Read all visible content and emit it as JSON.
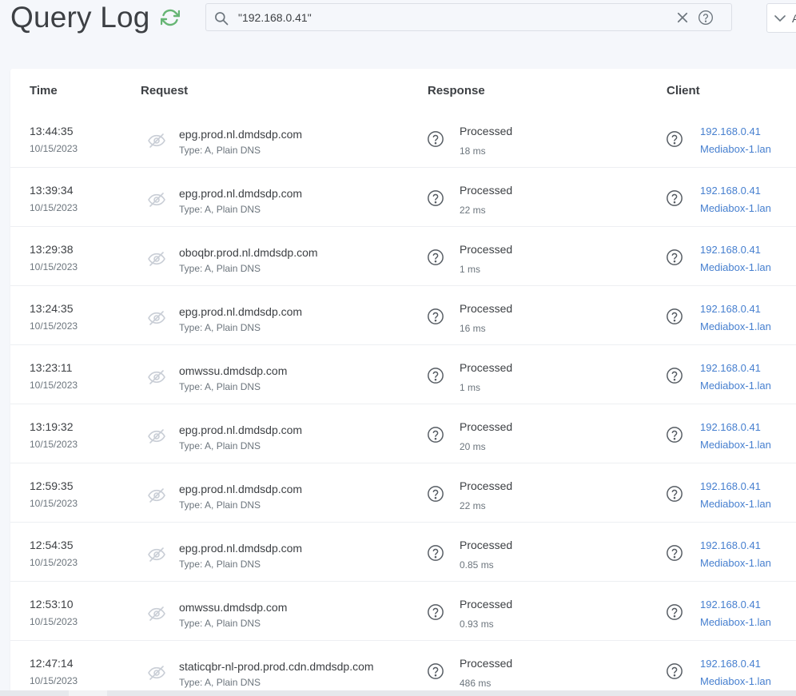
{
  "header": {
    "title": "Query Log",
    "refresh_icon": "refresh-icon",
    "search": {
      "value": "\"192.168.0.41\"",
      "placeholder": ""
    },
    "filter": {
      "label": "A"
    }
  },
  "table": {
    "columns": {
      "time": "Time",
      "request": "Request",
      "response": "Response",
      "client": "Client"
    },
    "rows": [
      {
        "time": "13:44:35",
        "date": "10/15/2023",
        "domain": "epg.prod.nl.dmdsdp.com",
        "type": "Type: A, Plain DNS",
        "status": "Processed",
        "elapsed": "18 ms",
        "ip": "192.168.0.41",
        "name": "Mediabox-1.lan"
      },
      {
        "time": "13:39:34",
        "date": "10/15/2023",
        "domain": "epg.prod.nl.dmdsdp.com",
        "type": "Type: A, Plain DNS",
        "status": "Processed",
        "elapsed": "22 ms",
        "ip": "192.168.0.41",
        "name": "Mediabox-1.lan"
      },
      {
        "time": "13:29:38",
        "date": "10/15/2023",
        "domain": "oboqbr.prod.nl.dmdsdp.com",
        "type": "Type: A, Plain DNS",
        "status": "Processed",
        "elapsed": "1 ms",
        "ip": "192.168.0.41",
        "name": "Mediabox-1.lan"
      },
      {
        "time": "13:24:35",
        "date": "10/15/2023",
        "domain": "epg.prod.nl.dmdsdp.com",
        "type": "Type: A, Plain DNS",
        "status": "Processed",
        "elapsed": "16 ms",
        "ip": "192.168.0.41",
        "name": "Mediabox-1.lan"
      },
      {
        "time": "13:23:11",
        "date": "10/15/2023",
        "domain": "omwssu.dmdsdp.com",
        "type": "Type: A, Plain DNS",
        "status": "Processed",
        "elapsed": "1 ms",
        "ip": "192.168.0.41",
        "name": "Mediabox-1.lan"
      },
      {
        "time": "13:19:32",
        "date": "10/15/2023",
        "domain": "epg.prod.nl.dmdsdp.com",
        "type": "Type: A, Plain DNS",
        "status": "Processed",
        "elapsed": "20 ms",
        "ip": "192.168.0.41",
        "name": "Mediabox-1.lan"
      },
      {
        "time": "12:59:35",
        "date": "10/15/2023",
        "domain": "epg.prod.nl.dmdsdp.com",
        "type": "Type: A, Plain DNS",
        "status": "Processed",
        "elapsed": "22 ms",
        "ip": "192.168.0.41",
        "name": "Mediabox-1.lan"
      },
      {
        "time": "12:54:35",
        "date": "10/15/2023",
        "domain": "epg.prod.nl.dmdsdp.com",
        "type": "Type: A, Plain DNS",
        "status": "Processed",
        "elapsed": "0.85 ms",
        "ip": "192.168.0.41",
        "name": "Mediabox-1.lan"
      },
      {
        "time": "12:53:10",
        "date": "10/15/2023",
        "domain": "omwssu.dmdsdp.com",
        "type": "Type: A, Plain DNS",
        "status": "Processed",
        "elapsed": "0.93 ms",
        "ip": "192.168.0.41",
        "name": "Mediabox-1.lan"
      },
      {
        "time": "12:47:14",
        "date": "10/15/2023",
        "domain": "staticqbr-nl-prod.prod.cdn.dmdsdp.com",
        "type": "Type: A, Plain DNS",
        "status": "Processed",
        "elapsed": "486 ms",
        "ip": "192.168.0.41",
        "name": "Mediabox-1.lan"
      }
    ]
  },
  "colors": {
    "accent_green": "#66b574",
    "link_blue": "#467fcf",
    "text_dark": "#3d4044",
    "text_muted": "#6c757d",
    "background": "#f5f7fb"
  },
  "icons": {
    "request": "eye-off-icon",
    "response_help": "question-circle-icon",
    "client_help": "question-circle-icon",
    "search": "search-icon",
    "clear": "close-icon",
    "filter": "chevron-down-icon"
  }
}
